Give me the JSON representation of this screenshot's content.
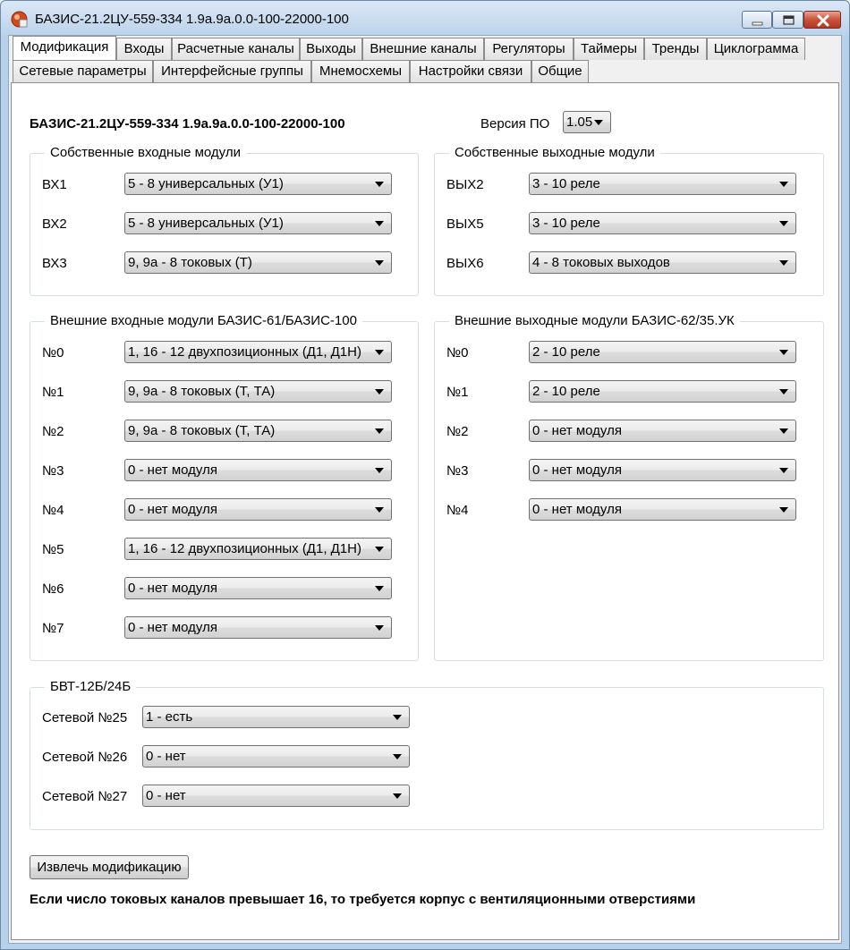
{
  "window": {
    "title": "БАЗИС-21.2ЦУ-559-334 1.9a.9a.0.0-100-22000-100"
  },
  "tabs_row1": [
    {
      "label": "Модификация",
      "active": true
    },
    {
      "label": "Входы"
    },
    {
      "label": "Расчетные каналы"
    },
    {
      "label": "Выходы"
    },
    {
      "label": "Внешние каналы"
    },
    {
      "label": "Регуляторы"
    },
    {
      "label": "Таймеры"
    },
    {
      "label": "Тренды"
    },
    {
      "label": "Циклограмма"
    }
  ],
  "tabs_row2": [
    {
      "label": "Сетевые параметры"
    },
    {
      "label": "Интерфейсные группы"
    },
    {
      "label": "Мнемосхемы"
    },
    {
      "label": "Настройки связи"
    },
    {
      "label": "Общие"
    }
  ],
  "header": {
    "device": "БАЗИС-21.2ЦУ-559-334 1.9a.9a.0.0-100-22000-100",
    "version_label": "Версия ПО",
    "version_value": "1.05"
  },
  "own_inputs": {
    "title": "Собственные входные модули",
    "rows": [
      {
        "label": "ВХ1",
        "value": "5 - 8 универсальных (У1)"
      },
      {
        "label": "ВХ2",
        "value": "5 - 8 универсальных (У1)"
      },
      {
        "label": "ВХ3",
        "value": "9, 9а - 8 токовых (Т)"
      }
    ]
  },
  "own_outputs": {
    "title": "Собственные выходные модули",
    "rows": [
      {
        "label": "ВЫХ2",
        "value": "3 - 10 реле"
      },
      {
        "label": "ВЫХ5",
        "value": "3 - 10 реле"
      },
      {
        "label": "ВЫХ6",
        "value": "4 - 8 токовых выходов"
      }
    ]
  },
  "ext_inputs": {
    "title": "Внешние входные модули БАЗИС-61/БАЗИС-100",
    "rows": [
      {
        "label": "№0",
        "value": "1, 16 - 12 двухпозиционных (Д1, Д1Н)"
      },
      {
        "label": "№1",
        "value": "9, 9а - 8 токовых (Т, ТА)"
      },
      {
        "label": "№2",
        "value": "9, 9а - 8 токовых (Т, ТА)"
      },
      {
        "label": "№3",
        "value": "0 - нет модуля"
      },
      {
        "label": "№4",
        "value": "0 - нет модуля"
      },
      {
        "label": "№5",
        "value": "1, 16 - 12 двухпозиционных (Д1, Д1Н)"
      },
      {
        "label": "№6",
        "value": "0 - нет модуля"
      },
      {
        "label": "№7",
        "value": "0 - нет модуля"
      }
    ]
  },
  "ext_outputs": {
    "title": "Внешние выходные модули БАЗИС-62/35.УК",
    "rows": [
      {
        "label": "№0",
        "value": "2 - 10 реле"
      },
      {
        "label": "№1",
        "value": "2 - 10 реле"
      },
      {
        "label": "№2",
        "value": "0 - нет модуля"
      },
      {
        "label": "№3",
        "value": "0 - нет модуля"
      },
      {
        "label": "№4",
        "value": "0 - нет модуля"
      }
    ]
  },
  "bvt": {
    "title": "БВТ-12Б/24Б",
    "rows": [
      {
        "label": "Сетевой №25",
        "value": "1 - есть"
      },
      {
        "label": "Сетевой №26",
        "value": "0 - нет"
      },
      {
        "label": "Сетевой №27",
        "value": "0 - нет"
      }
    ]
  },
  "extract_button": "Извлечь модификацию",
  "note": "Если число токовых каналов превышает 16, то требуется корпус с вентиляционными отверстиями"
}
